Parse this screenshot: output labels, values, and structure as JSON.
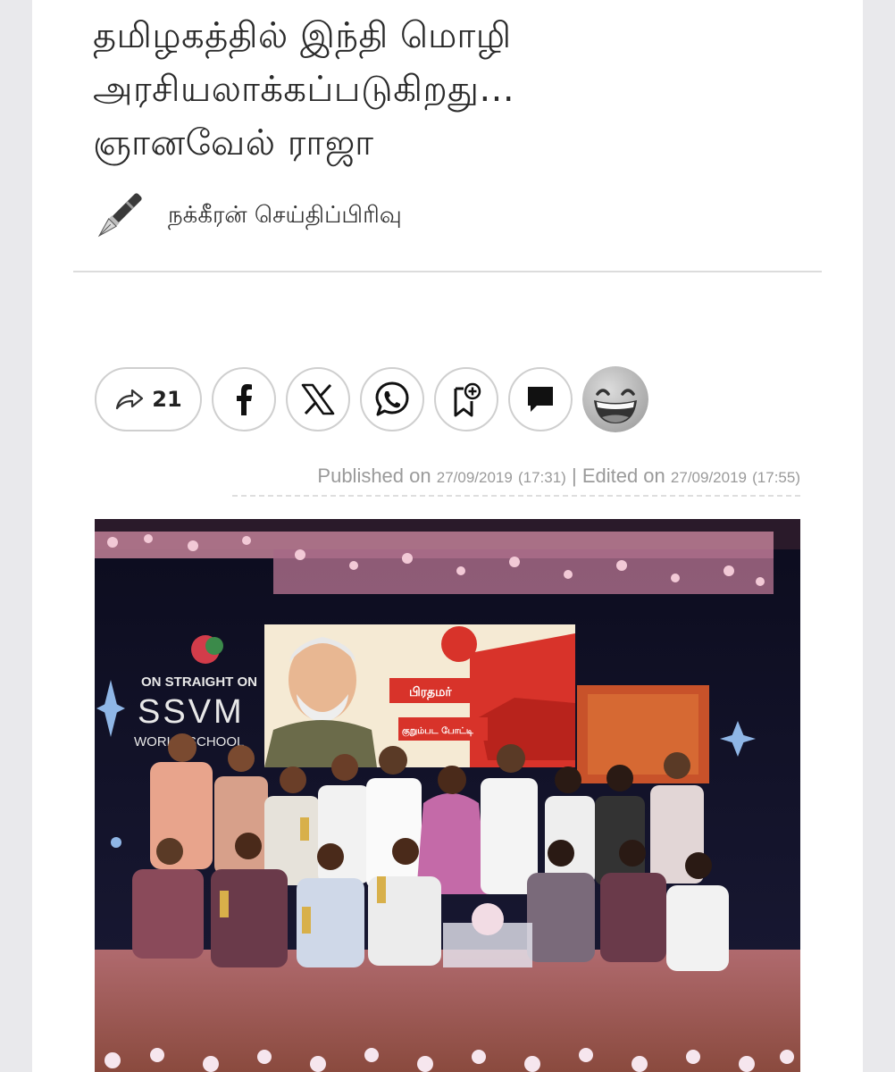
{
  "article": {
    "headline_line1": "தமிழகத்தில் இந்தி மொழி",
    "headline_line2": "அரசியலாக்கப்படுகிறது...",
    "headline_line3": "ஞானவேல் ராஜா",
    "author": "நக்கீரன் செய்திப்பிரிவு"
  },
  "share_bar": {
    "share_count": "21",
    "buttons": [
      "share-icon",
      "facebook-icon",
      "x-icon",
      "whatsapp-icon",
      "bookmark-add-icon",
      "comment-icon",
      "grinning-face-icon"
    ]
  },
  "meta": {
    "published_label": "Published on",
    "published_date": "27/09/2019",
    "published_time": "(17:31)",
    "separator": "|",
    "edited_label": "Edited on",
    "edited_date": "27/09/2019",
    "edited_time": "(17:55)"
  },
  "photo": {
    "stage_banner_line1": "ON   STRAIGHT ON",
    "stage_banner_line2": "SSVM",
    "stage_banner_line3": "WORLD SCHOOL",
    "screen_text1": "பிரதமர்",
    "screen_text2": "குறும்பட போட்டி"
  },
  "colors": {
    "headline": "#2b2b2b",
    "meta_text": "#9a9a9a",
    "stage_backdrop": "#12122a",
    "screen_red": "#d8332a"
  }
}
